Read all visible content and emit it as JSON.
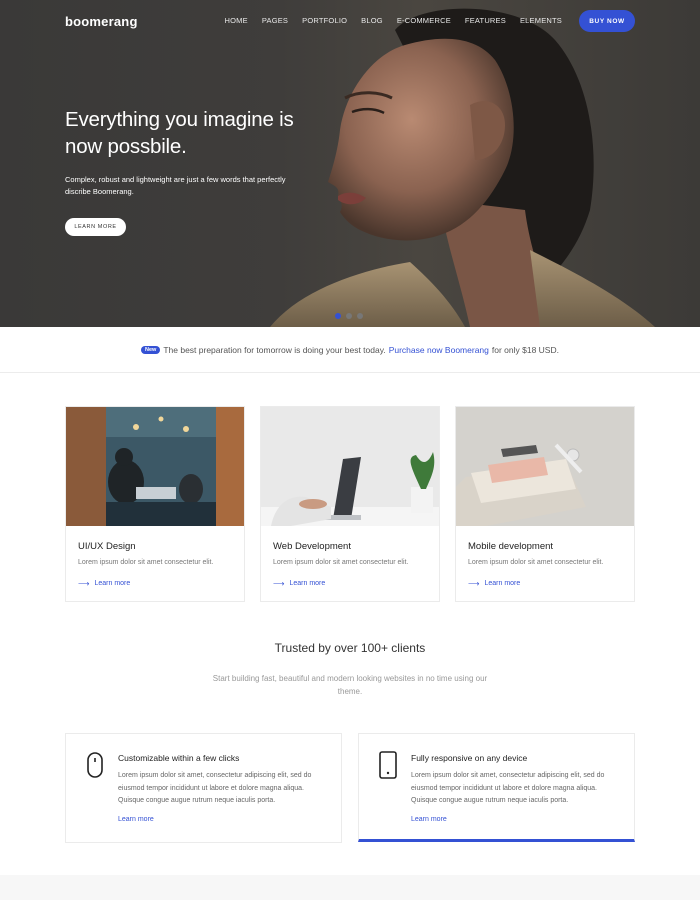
{
  "nav": {
    "logo": "boomerang",
    "items": [
      "HOME",
      "PAGES",
      "PORTFOLIO",
      "BLOG",
      "E-COMMERCE",
      "FEATURES",
      "ELEMENTS"
    ],
    "buy_label": "BUY NOW"
  },
  "hero": {
    "title": "Everything you imagine is now possbile.",
    "subtitle": "Complex, robust and lightweight are just a few words that perfectly discribe Boomerang.",
    "button_label": "LEARN MORE",
    "slides": 3,
    "active_slide": 1
  },
  "promo": {
    "badge": "New",
    "text_before": "The best preparation for tomorrow is doing your best today.",
    "link": "Purchase now Boomerang",
    "text_after": "for only $18 USD."
  },
  "cards": [
    {
      "title": "UI/UX Design",
      "text": "Lorem ipsum dolor sit amet consectetur elit.",
      "link": "Learn more"
    },
    {
      "title": "Web Development",
      "text": "Lorem ipsum dolor sit amet consectetur elit.",
      "link": "Learn more"
    },
    {
      "title": "Mobile development",
      "text": "Lorem ipsum dolor sit amet consectetur elit.",
      "link": "Learn more"
    }
  ],
  "trusted": {
    "title": "Trusted by over 100+ clients",
    "subtitle": "Start building fast, beautiful and modern looking websites in no time using our theme."
  },
  "features": [
    {
      "icon": "mouse-icon",
      "title": "Customizable within a few clicks",
      "text": "Lorem ipsum dolor sit amet, consectetur adipiscing elit, sed do eiusmod tempor incididunt ut labore et dolore magna aliqua. Quisque congue augue rutrum neque iaculis porta.",
      "link": "Learn more"
    },
    {
      "icon": "tablet-icon",
      "title": "Fully responsive on any device",
      "text": "Lorem ipsum dolor sit amet, consectetur adipiscing elit, sed do eiusmod tempor incididunt ut labore et dolore magna aliqua. Quisque congue augue rutrum neque iaculis porta.",
      "link": "Learn more"
    }
  ],
  "colors": {
    "accent": "#3451d4",
    "hero_bg": "#3d3b39"
  }
}
